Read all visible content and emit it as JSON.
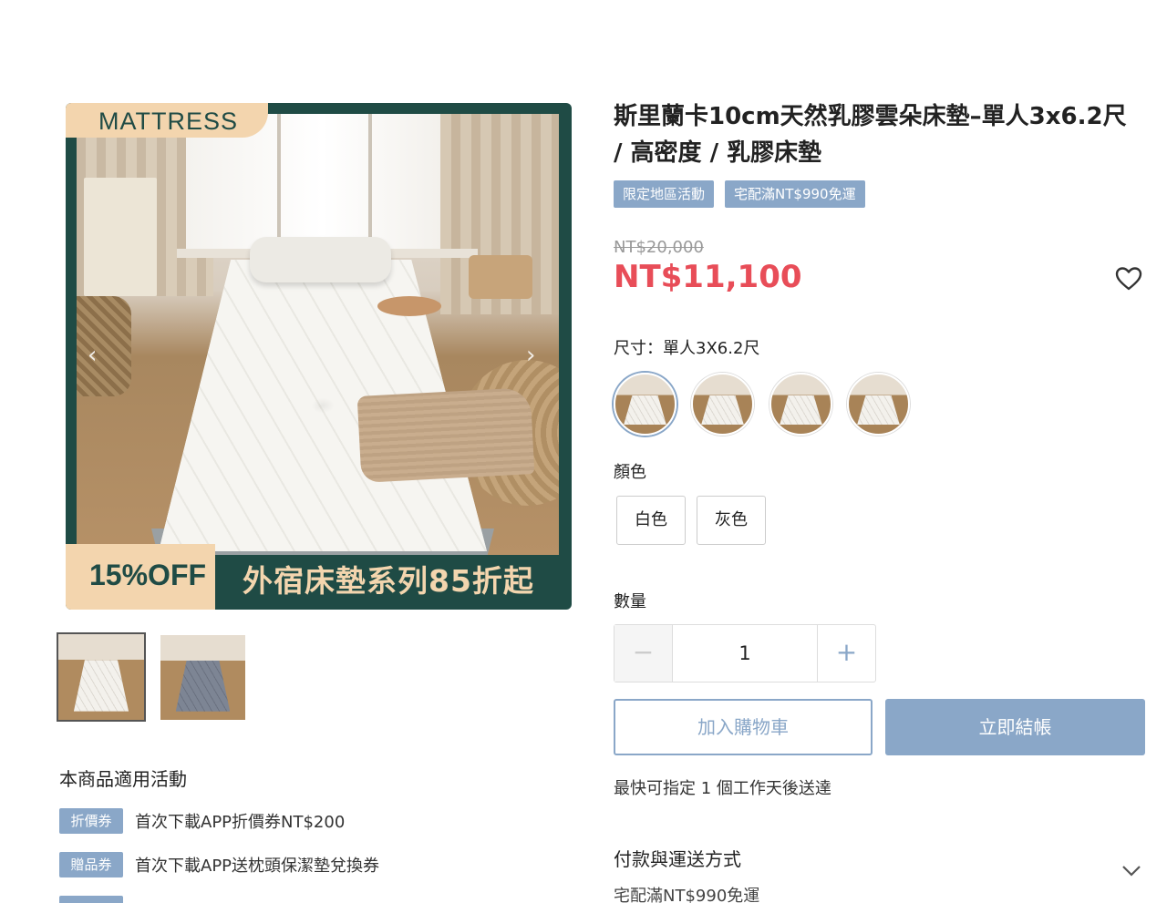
{
  "product": {
    "title": "斯里蘭卡10cm天然乳膠雲朵床墊–單人3x6.2尺 / 高密度 / 乳膠床墊",
    "tags": [
      "限定地區活動",
      "宅配滿NT$990免運"
    ],
    "price_original": "NT$20,000",
    "price_sale": "NT$11,100"
  },
  "gallery": {
    "corner_label": "MATTRESS",
    "promo_left": "15%OFF",
    "promo_right": "外宿床墊系列85折起",
    "prev_arrow": "‹",
    "next_arrow": "›",
    "thumbnails": [
      "white-mattress",
      "gray-mattress"
    ]
  },
  "options": {
    "size_label": "尺寸：單人3X6.2尺",
    "color_label": "顏色",
    "colors": [
      "白色",
      "灰色"
    ],
    "quantity_label": "數量",
    "quantity_value": "1",
    "minus": "−",
    "plus": "+"
  },
  "actions": {
    "add_to_cart": "加入購物車",
    "buy_now": "立即結帳"
  },
  "delivery": {
    "note": "最快可指定 1 個工作天後送達",
    "payment_title": "付款與運送方式",
    "payment_sub": "宅配滿NT$990免運"
  },
  "activities": {
    "title": "本商品適用活動",
    "items": [
      {
        "badge": "折價券",
        "text": "首次下載APP折價券NT$200"
      },
      {
        "badge": "贈品券",
        "text": "首次下載APP送枕頭保潔墊兌換券"
      }
    ]
  },
  "colors": {
    "accent": "#8aa7c8",
    "sale": "#e84d58",
    "banner_green": "#1f4b45",
    "banner_peach": "#f3d5ae"
  },
  "icons": [
    "heart-icon",
    "chevron-down-icon",
    "chevron-left-icon",
    "chevron-right-icon"
  ]
}
